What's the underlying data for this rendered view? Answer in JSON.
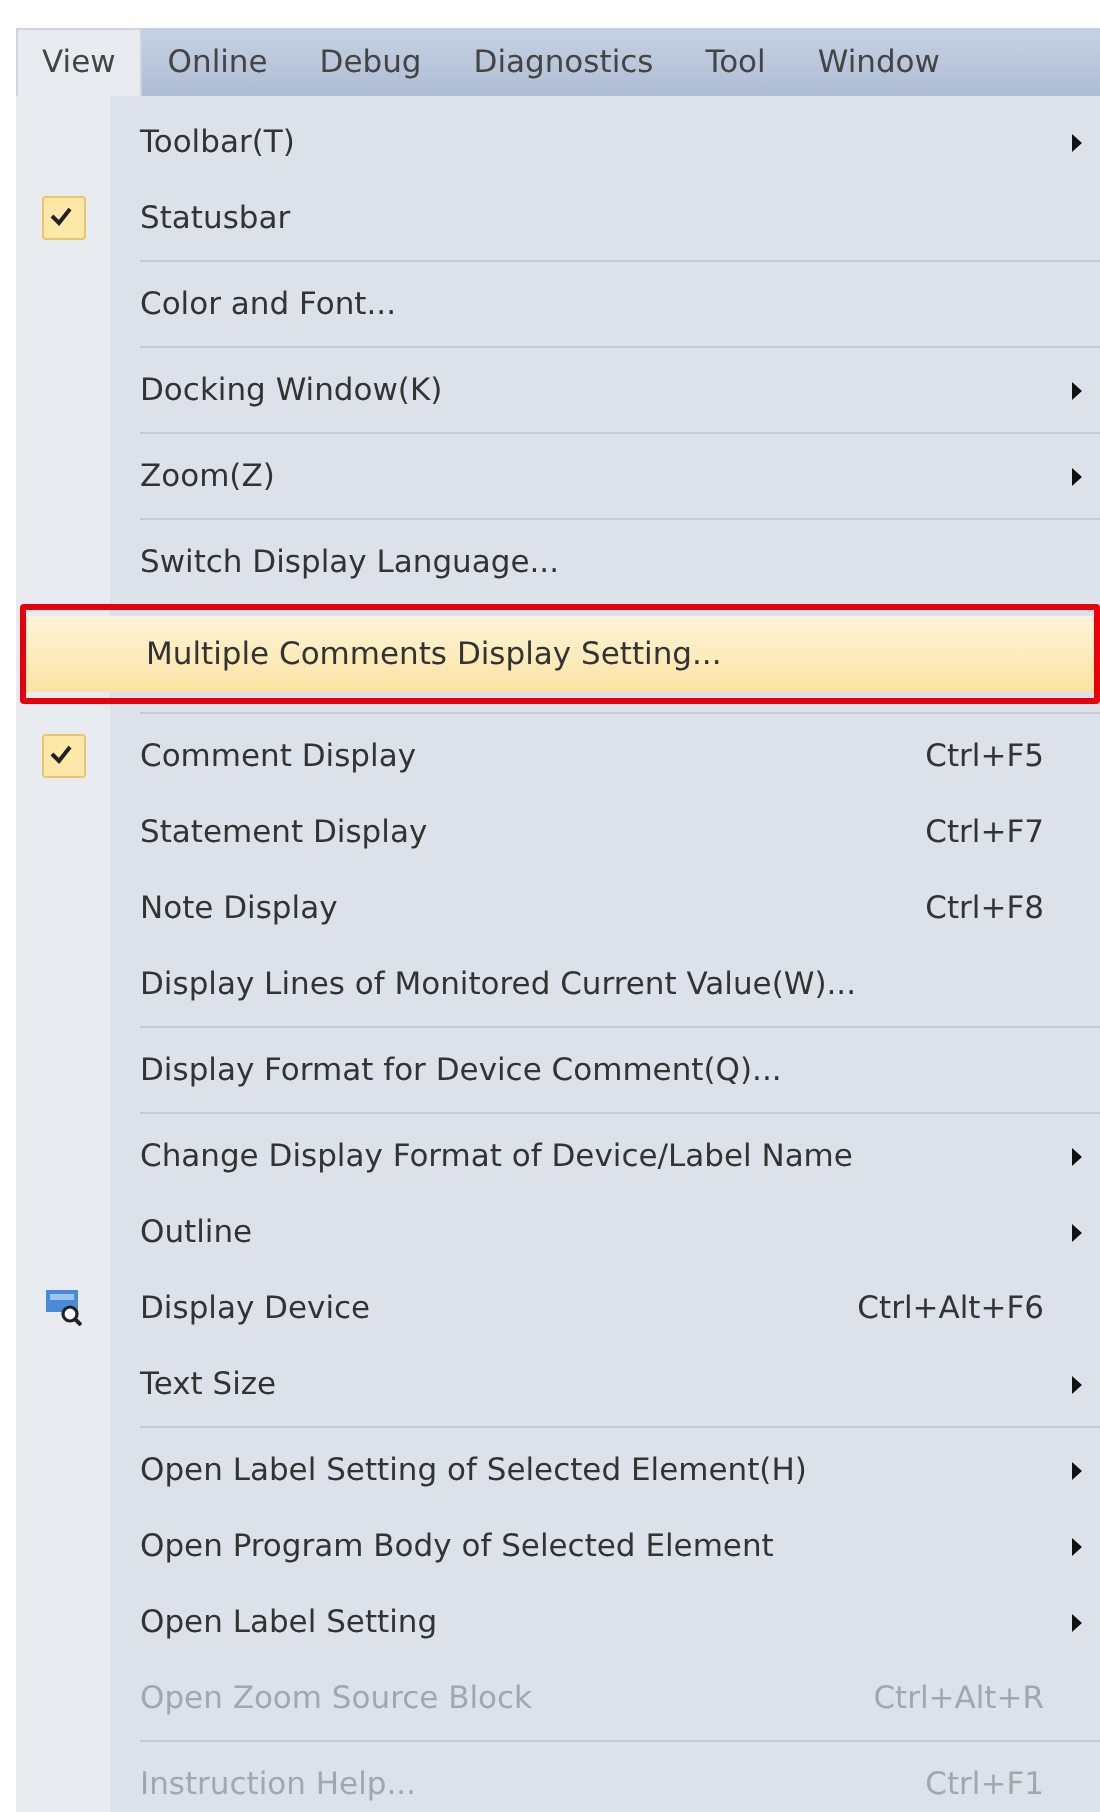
{
  "menu_bar": [
    {
      "label": "View",
      "selected": true
    },
    {
      "label": "Online",
      "selected": false
    },
    {
      "label": "Debug",
      "selected": false
    },
    {
      "label": "Diagnostics",
      "selected": false
    },
    {
      "label": "Tool",
      "selected": false
    },
    {
      "label": "Window",
      "selected": false
    }
  ],
  "menu": {
    "items": [
      {
        "label": "Toolbar(T)",
        "submenu": true,
        "separator_before": false,
        "checked": false,
        "disabled": false,
        "selected": false,
        "outlined": false
      },
      {
        "label": "Statusbar",
        "submenu": false,
        "separator_before": false,
        "checked": true,
        "disabled": false,
        "selected": false,
        "outlined": false
      },
      {
        "label": "Color and Font...",
        "submenu": false,
        "separator_before": true,
        "checked": false,
        "disabled": false,
        "selected": false,
        "outlined": false
      },
      {
        "label": "Docking Window(K)",
        "submenu": true,
        "separator_before": true,
        "checked": false,
        "disabled": false,
        "selected": false,
        "outlined": false
      },
      {
        "label": "Zoom(Z)",
        "submenu": true,
        "separator_before": true,
        "checked": false,
        "disabled": false,
        "selected": false,
        "outlined": false
      },
      {
        "label": "Switch Display Language...",
        "submenu": false,
        "separator_before": true,
        "checked": false,
        "disabled": false,
        "selected": false,
        "outlined": false
      },
      {
        "label": "Multiple Comments Display Setting...",
        "submenu": false,
        "separator_before": true,
        "checked": false,
        "disabled": false,
        "selected": true,
        "outlined": true
      },
      {
        "label": "Comment Display",
        "shortcut": "Ctrl+F5",
        "submenu": false,
        "separator_before": true,
        "checked": true,
        "disabled": false,
        "selected": false,
        "outlined": false
      },
      {
        "label": "Statement Display",
        "shortcut": "Ctrl+F7",
        "submenu": false,
        "separator_before": false,
        "checked": false,
        "disabled": false,
        "selected": false,
        "outlined": false
      },
      {
        "label": "Note Display",
        "shortcut": "Ctrl+F8",
        "submenu": false,
        "separator_before": false,
        "checked": false,
        "disabled": false,
        "selected": false,
        "outlined": false
      },
      {
        "label": "Display Lines of Monitored Current Value(W)...",
        "submenu": false,
        "separator_before": false,
        "checked": false,
        "disabled": false,
        "selected": false,
        "outlined": false
      },
      {
        "label": "Display Format for Device Comment(Q)...",
        "submenu": false,
        "separator_before": true,
        "checked": false,
        "disabled": false,
        "selected": false,
        "outlined": false
      },
      {
        "label": "Change Display Format of Device/Label Name",
        "submenu": true,
        "separator_before": true,
        "checked": false,
        "disabled": false,
        "selected": false,
        "outlined": false
      },
      {
        "label": "Outline",
        "submenu": true,
        "separator_before": false,
        "checked": false,
        "disabled": false,
        "selected": false,
        "outlined": false
      },
      {
        "label": "Display Device",
        "shortcut": "Ctrl+Alt+F6",
        "kind": "icon",
        "submenu": false,
        "separator_before": false,
        "checked": false,
        "disabled": false,
        "selected": false,
        "outlined": false
      },
      {
        "label": "Text Size",
        "submenu": true,
        "separator_before": false,
        "checked": false,
        "disabled": false,
        "selected": false,
        "outlined": false
      },
      {
        "label": "Open Label Setting of Selected Element(H)",
        "submenu": true,
        "separator_before": true,
        "checked": false,
        "disabled": false,
        "selected": false,
        "outlined": false
      },
      {
        "label": "Open Program Body of Selected Element",
        "submenu": true,
        "separator_before": false,
        "checked": false,
        "disabled": false,
        "selected": false,
        "outlined": false
      },
      {
        "label": "Open Label Setting",
        "submenu": true,
        "separator_before": false,
        "checked": false,
        "disabled": false,
        "selected": false,
        "outlined": false
      },
      {
        "label": "Open Zoom Source Block",
        "shortcut": "Ctrl+Alt+R",
        "submenu": false,
        "separator_before": false,
        "checked": false,
        "disabled": true,
        "selected": false,
        "outlined": false
      },
      {
        "label": "Instruction Help...",
        "shortcut": "Ctrl+F1",
        "submenu": false,
        "separator_before": true,
        "checked": false,
        "disabled": true,
        "selected": false,
        "outlined": false
      }
    ]
  }
}
